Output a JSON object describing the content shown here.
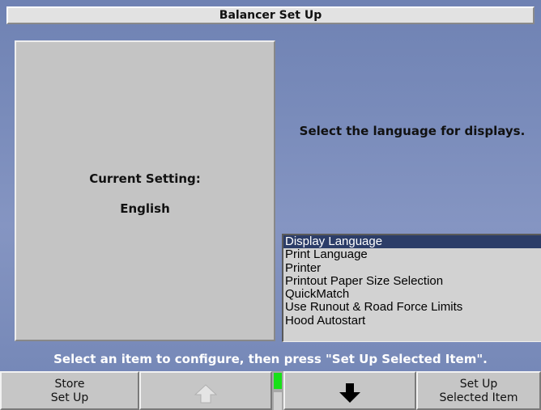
{
  "window": {
    "title": "Balancer Set Up"
  },
  "setting": {
    "label": "Current Setting:",
    "value": "English"
  },
  "instruction": "Select the language for displays.",
  "menu": {
    "items": [
      "Display Language",
      "Print Language",
      "Printer",
      "Printout Paper Size Selection",
      "QuickMatch",
      "Use Runout & Road Force Limits",
      "Hood Autostart"
    ],
    "selected_index": 0
  },
  "status": "Select an item to configure, then press \"Set Up Selected Item\".",
  "softkeys": {
    "store": {
      "line1": "Store",
      "line2": "Set Up"
    },
    "up": {
      "icon": "arrow-up-icon",
      "enabled": false
    },
    "down": {
      "icon": "arrow-down-icon",
      "enabled": true
    },
    "setup_selected": {
      "line1": "Set Up",
      "line2": "Selected Item"
    }
  },
  "colors": {
    "selection": "#2c3d68",
    "indicator_active": "#18e018"
  }
}
